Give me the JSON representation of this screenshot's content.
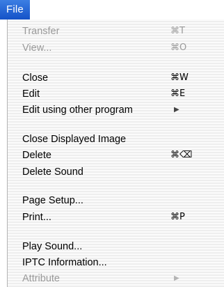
{
  "menubar": {
    "title": "File"
  },
  "menu": {
    "items": [
      {
        "label": "Transfer",
        "shortcut": "⌘T"
      },
      {
        "label": "View...",
        "shortcut": "⌘O"
      },
      {
        "label": "Close",
        "shortcut": "⌘W"
      },
      {
        "label": "Edit",
        "shortcut": "⌘E"
      },
      {
        "label": "Edit using other program",
        "submenu_arrow": "▶"
      },
      {
        "label": "Close Displayed Image"
      },
      {
        "label": "Delete",
        "shortcut": "⌘⌫"
      },
      {
        "label": "Delete Sound"
      },
      {
        "label": "Page Setup..."
      },
      {
        "label": "Print...",
        "shortcut": "⌘P"
      },
      {
        "label": "Play Sound..."
      },
      {
        "label": "IPTC Information..."
      },
      {
        "label": "Attribute",
        "submenu_arrow": "▶"
      }
    ],
    "disabled_items": [
      "Transfer",
      "View...",
      "Attribute"
    ]
  },
  "colors": {
    "menu_title_bg": "#2a63d6",
    "menu_title_text": "#ffffff",
    "enabled_text": "#000000",
    "disabled_text": "#9a9a9a"
  }
}
